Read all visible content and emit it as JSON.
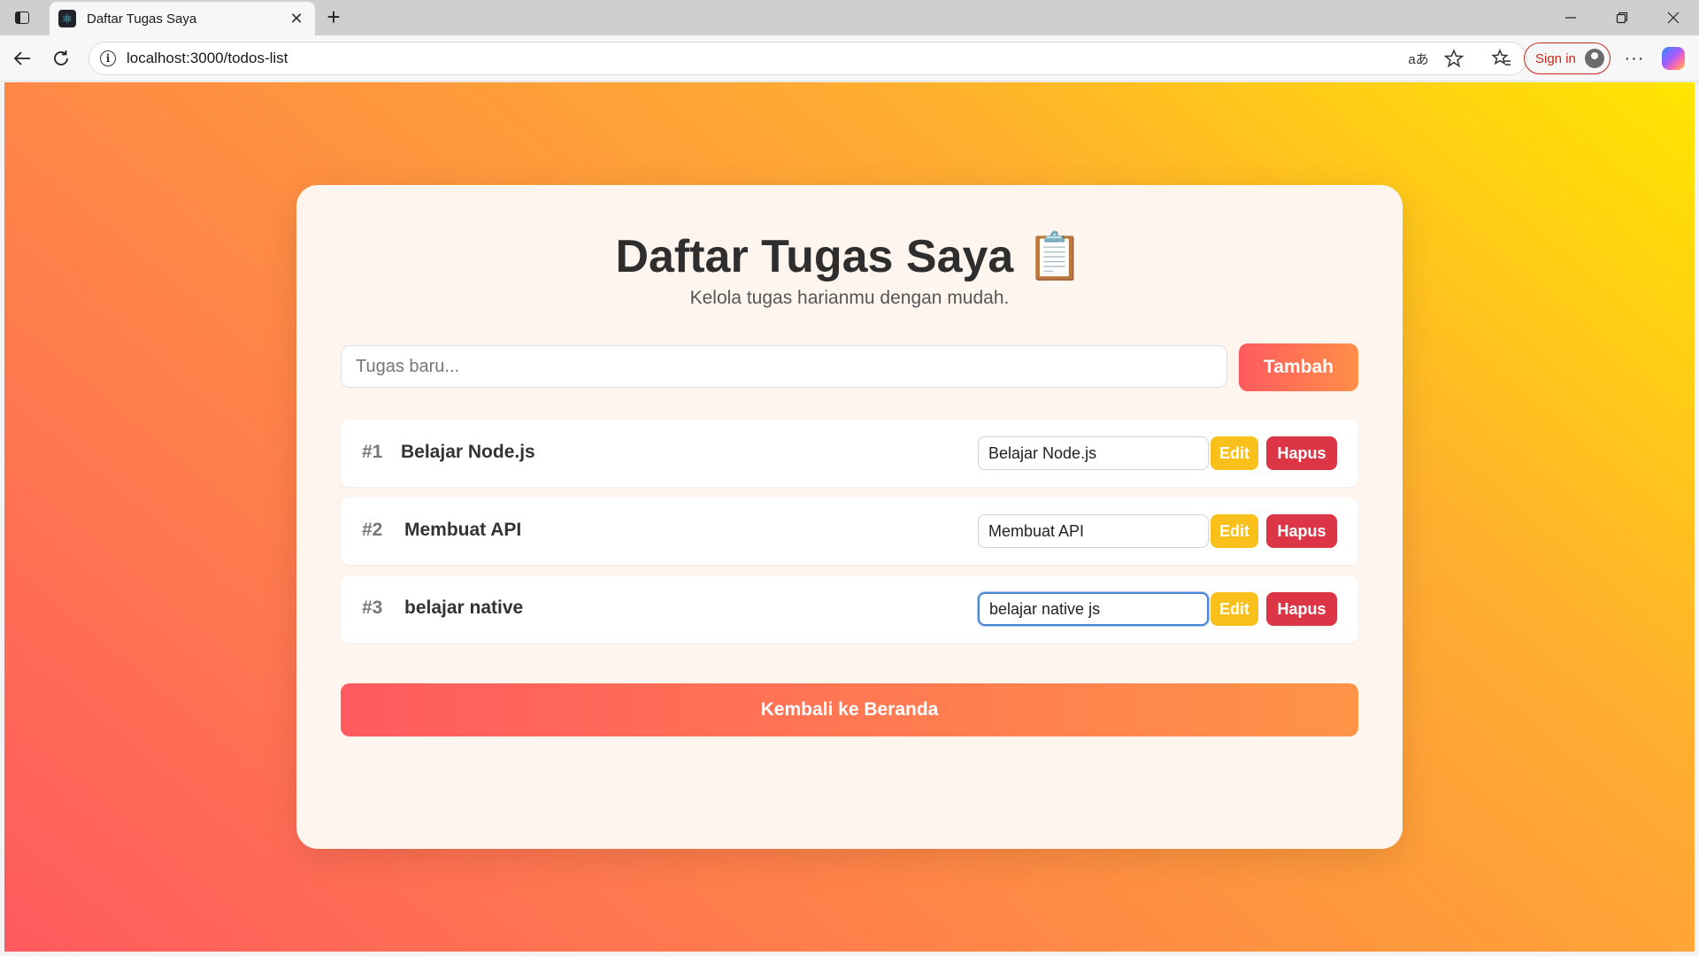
{
  "browser": {
    "tab_title": "Daftar Tugas Saya",
    "url": "localhost:3000/todos-list",
    "signin_label": "Sign in",
    "new_tab_glyph": "+",
    "tab_close_glyph": "✕",
    "read_aloud_glyph": "aあ",
    "icons": [
      "sidebar-toggle-icon",
      "react-favicon-icon",
      "back-arrow-icon",
      "reload-icon",
      "info-icon",
      "read-aloud-icon",
      "favorite-star-icon",
      "favorites-icon",
      "profile-avatar-icon",
      "more-options-icon",
      "copilot-icon"
    ]
  },
  "page": {
    "title": "Daftar Tugas Saya 📋",
    "subtitle": "Kelola tugas harianmu dengan mudah.",
    "new_task_placeholder": "Tugas baru...",
    "add_label": "Tambah",
    "back_label": "Kembali ke Beranda"
  },
  "todos": [
    {
      "number": "#1",
      "text": "Belajar Node.js",
      "edit_value": "Belajar Node.js",
      "edit_label": "Edit",
      "delete_label": "Hapus"
    },
    {
      "number": "#2",
      "text": "Membuat API",
      "edit_value": "Membuat API",
      "edit_label": "Edit",
      "delete_label": "Hapus"
    },
    {
      "number": "#3",
      "text": "belajar native",
      "edit_value": "belajar native js",
      "edit_label": "Edit",
      "delete_label": "Hapus"
    }
  ],
  "colors": {
    "gradient_start": "#ff5a5f",
    "gradient_end": "#ffe600",
    "edit_button": "#f9c01b",
    "delete_button": "#dc3545",
    "signin_accent": "#c42b1c"
  }
}
